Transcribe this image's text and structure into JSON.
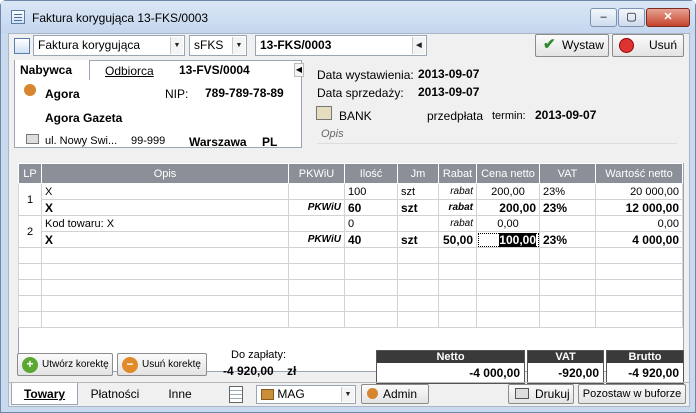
{
  "window": {
    "title": "Faktura korygująca 13-FKS/0003"
  },
  "toolbar": {
    "doc_type": "Faktura korygująca",
    "series": "sFKS",
    "number": "13-FKS/0003",
    "issue_label": "Wystaw",
    "delete_label": "Usuń"
  },
  "party": {
    "tabs": [
      "Nabywca",
      "Odbiorca",
      "13-FVS/0004"
    ],
    "name": "Agora",
    "nip_label": "NIP:",
    "nip": "789-789-78-89",
    "full_name": "Agora Gazeta",
    "street": "ul. Nowy Swi...",
    "postal": "99-999",
    "city": "Warszawa",
    "country": "PL"
  },
  "dates": {
    "issue_label": "Data wystawienia:",
    "issue": "2013-09-07",
    "sale_label": "Data sprzedaży:",
    "sale": "2013-09-07",
    "payment_method": "BANK",
    "payment_type": "przedpłata",
    "term_label": "termin:",
    "term": "2013-09-07",
    "desc_placeholder": "Opis"
  },
  "table": {
    "headers": [
      "LP",
      "Opis",
      "PKWiU",
      "Ilość",
      "Jm",
      "Rabat",
      "Cena netto",
      "VAT",
      "Wartość netto"
    ],
    "rows": [
      {
        "lp": "1",
        "desc": "X",
        "pkwiu": "",
        "qty": "100",
        "jm": "szt",
        "rabat": "rabat",
        "price": "200,00",
        "vat": "23%",
        "value": "20 000,00",
        "bold": false
      },
      {
        "lp": "",
        "desc": "X",
        "pkwiu": "PKWiU",
        "qty": "60",
        "jm": "szt",
        "rabat": "rabat",
        "price": "200,00",
        "vat": "23%",
        "value": "12 000,00",
        "bold": true
      },
      {
        "lp": "2",
        "desc": "Kod towaru: X",
        "pkwiu": "",
        "qty": "0",
        "jm": "",
        "rabat": "rabat",
        "price": "0,00",
        "vat": "",
        "value": "0,00",
        "bold": false
      },
      {
        "lp": "",
        "desc": "X",
        "pkwiu": "PKWiU",
        "qty": "40",
        "jm": "szt",
        "rabat": "50,00",
        "price": "100,00",
        "vat": "23%",
        "value": "4 000,00",
        "bold": true
      }
    ]
  },
  "bottom": {
    "create_corr": "Utwórz korektę",
    "delete_corr": "Usuń korektę",
    "to_pay_label": "Do zapłaty:",
    "to_pay": "-4 920,00",
    "currency": "zł",
    "netto_label": "Netto",
    "netto": "-4 000,00",
    "vat_label": "VAT",
    "vat": "-920,00",
    "brutto_label": "Brutto",
    "brutto": "-4 920,00"
  },
  "footer": {
    "tabs": [
      "Towary",
      "Płatności",
      "Inne"
    ],
    "warehouse": "MAG",
    "user": "Admin",
    "print": "Drukuj",
    "leave": "Pozostaw w buforze"
  }
}
